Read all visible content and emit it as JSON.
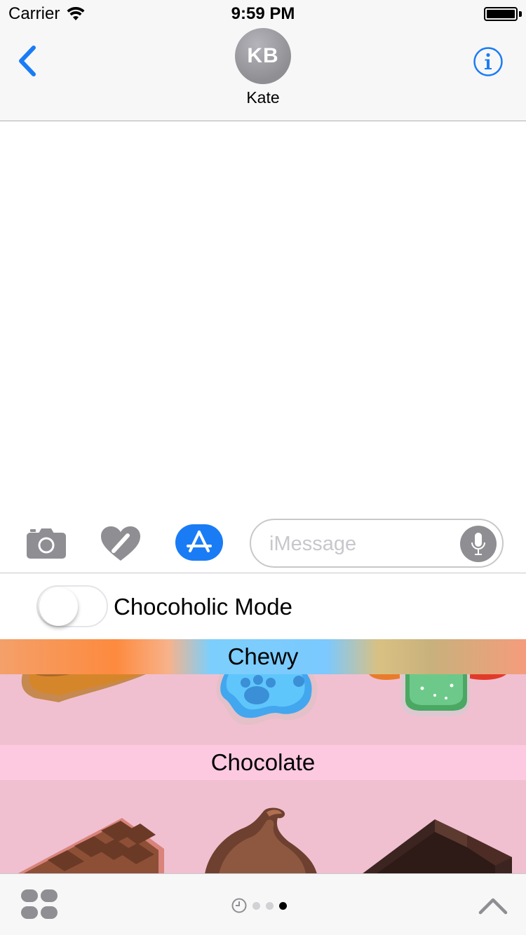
{
  "status_bar": {
    "carrier": "Carrier",
    "time": "9:59 PM"
  },
  "nav": {
    "avatar_initials": "KB",
    "contact_name": "Kate"
  },
  "input": {
    "placeholder": "iMessage"
  },
  "extension": {
    "toggle_label": "Chocoholic Mode",
    "toggle_on": false,
    "sections": [
      {
        "title": "Chewy"
      },
      {
        "title": "Chocolate"
      }
    ]
  },
  "bottom": {
    "page_count": 3,
    "active_page": 3
  },
  "colors": {
    "accent": "#1a7cf5",
    "sticker_background": "#f0c0d1",
    "chocolate_header": "#fdc9e1"
  }
}
